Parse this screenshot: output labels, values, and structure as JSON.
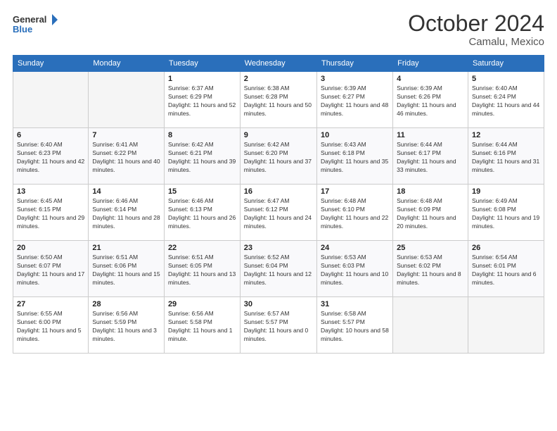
{
  "header": {
    "logo_line1": "General",
    "logo_line2": "Blue",
    "month": "October 2024",
    "location": "Camalu, Mexico"
  },
  "weekdays": [
    "Sunday",
    "Monday",
    "Tuesday",
    "Wednesday",
    "Thursday",
    "Friday",
    "Saturday"
  ],
  "weeks": [
    [
      {
        "day": "",
        "empty": true
      },
      {
        "day": "",
        "empty": true
      },
      {
        "day": "1",
        "sunrise": "6:37 AM",
        "sunset": "6:29 PM",
        "daylight": "11 hours and 52 minutes."
      },
      {
        "day": "2",
        "sunrise": "6:38 AM",
        "sunset": "6:28 PM",
        "daylight": "11 hours and 50 minutes."
      },
      {
        "day": "3",
        "sunrise": "6:39 AM",
        "sunset": "6:27 PM",
        "daylight": "11 hours and 48 minutes."
      },
      {
        "day": "4",
        "sunrise": "6:39 AM",
        "sunset": "6:26 PM",
        "daylight": "11 hours and 46 minutes."
      },
      {
        "day": "5",
        "sunrise": "6:40 AM",
        "sunset": "6:24 PM",
        "daylight": "11 hours and 44 minutes."
      }
    ],
    [
      {
        "day": "6",
        "sunrise": "6:40 AM",
        "sunset": "6:23 PM",
        "daylight": "11 hours and 42 minutes."
      },
      {
        "day": "7",
        "sunrise": "6:41 AM",
        "sunset": "6:22 PM",
        "daylight": "11 hours and 40 minutes."
      },
      {
        "day": "8",
        "sunrise": "6:42 AM",
        "sunset": "6:21 PM",
        "daylight": "11 hours and 39 minutes."
      },
      {
        "day": "9",
        "sunrise": "6:42 AM",
        "sunset": "6:20 PM",
        "daylight": "11 hours and 37 minutes."
      },
      {
        "day": "10",
        "sunrise": "6:43 AM",
        "sunset": "6:18 PM",
        "daylight": "11 hours and 35 minutes."
      },
      {
        "day": "11",
        "sunrise": "6:44 AM",
        "sunset": "6:17 PM",
        "daylight": "11 hours and 33 minutes."
      },
      {
        "day": "12",
        "sunrise": "6:44 AM",
        "sunset": "6:16 PM",
        "daylight": "11 hours and 31 minutes."
      }
    ],
    [
      {
        "day": "13",
        "sunrise": "6:45 AM",
        "sunset": "6:15 PM",
        "daylight": "11 hours and 29 minutes."
      },
      {
        "day": "14",
        "sunrise": "6:46 AM",
        "sunset": "6:14 PM",
        "daylight": "11 hours and 28 minutes."
      },
      {
        "day": "15",
        "sunrise": "6:46 AM",
        "sunset": "6:13 PM",
        "daylight": "11 hours and 26 minutes."
      },
      {
        "day": "16",
        "sunrise": "6:47 AM",
        "sunset": "6:12 PM",
        "daylight": "11 hours and 24 minutes."
      },
      {
        "day": "17",
        "sunrise": "6:48 AM",
        "sunset": "6:10 PM",
        "daylight": "11 hours and 22 minutes."
      },
      {
        "day": "18",
        "sunrise": "6:48 AM",
        "sunset": "6:09 PM",
        "daylight": "11 hours and 20 minutes."
      },
      {
        "day": "19",
        "sunrise": "6:49 AM",
        "sunset": "6:08 PM",
        "daylight": "11 hours and 19 minutes."
      }
    ],
    [
      {
        "day": "20",
        "sunrise": "6:50 AM",
        "sunset": "6:07 PM",
        "daylight": "11 hours and 17 minutes."
      },
      {
        "day": "21",
        "sunrise": "6:51 AM",
        "sunset": "6:06 PM",
        "daylight": "11 hours and 15 minutes."
      },
      {
        "day": "22",
        "sunrise": "6:51 AM",
        "sunset": "6:05 PM",
        "daylight": "11 hours and 13 minutes."
      },
      {
        "day": "23",
        "sunrise": "6:52 AM",
        "sunset": "6:04 PM",
        "daylight": "11 hours and 12 minutes."
      },
      {
        "day": "24",
        "sunrise": "6:53 AM",
        "sunset": "6:03 PM",
        "daylight": "11 hours and 10 minutes."
      },
      {
        "day": "25",
        "sunrise": "6:53 AM",
        "sunset": "6:02 PM",
        "daylight": "11 hours and 8 minutes."
      },
      {
        "day": "26",
        "sunrise": "6:54 AM",
        "sunset": "6:01 PM",
        "daylight": "11 hours and 6 minutes."
      }
    ],
    [
      {
        "day": "27",
        "sunrise": "6:55 AM",
        "sunset": "6:00 PM",
        "daylight": "11 hours and 5 minutes."
      },
      {
        "day": "28",
        "sunrise": "6:56 AM",
        "sunset": "5:59 PM",
        "daylight": "11 hours and 3 minutes."
      },
      {
        "day": "29",
        "sunrise": "6:56 AM",
        "sunset": "5:58 PM",
        "daylight": "11 hours and 1 minute."
      },
      {
        "day": "30",
        "sunrise": "6:57 AM",
        "sunset": "5:57 PM",
        "daylight": "11 hours and 0 minutes."
      },
      {
        "day": "31",
        "sunrise": "6:58 AM",
        "sunset": "5:57 PM",
        "daylight": "10 hours and 58 minutes."
      },
      {
        "day": "",
        "empty": true
      },
      {
        "day": "",
        "empty": true
      }
    ]
  ],
  "labels": {
    "sunrise": "Sunrise:",
    "sunset": "Sunset:",
    "daylight": "Daylight:"
  }
}
